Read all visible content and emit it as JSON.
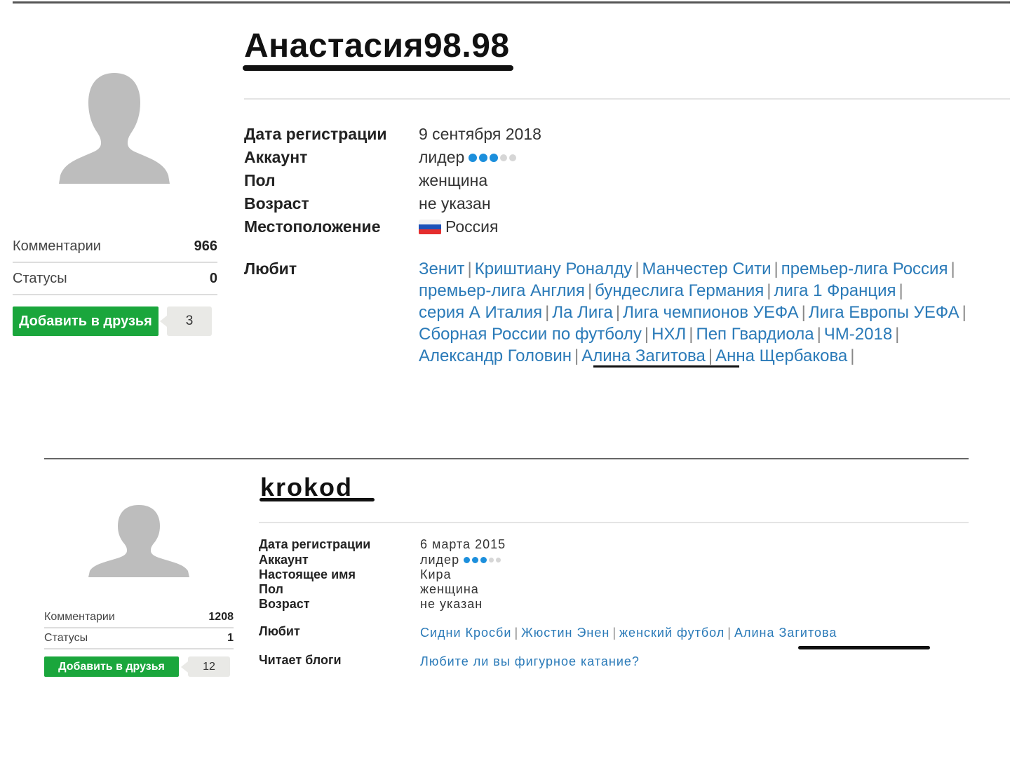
{
  "profile1": {
    "username": "Анастасия98.98",
    "stats": {
      "comments_label": "Комментарии",
      "comments_value": "966",
      "statuses_label": "Статусы",
      "statuses_value": "0"
    },
    "add_friend_label": "Добавить в друзья",
    "friend_count": "3",
    "info": {
      "reg_label": "Дата регистрации",
      "reg_value": "9 сентября 2018",
      "account_label": "Аккаунт",
      "account_value": "лидер",
      "account_level": 3,
      "account_level_max": 5,
      "gender_label": "Пол",
      "gender_value": "женщина",
      "age_label": "Возраст",
      "age_value": "не указан",
      "location_label": "Местоположение",
      "location_value": "Россия",
      "likes_label": "Любит"
    },
    "likes": [
      [
        "Зенит",
        "Криштиану Роналду",
        "Манчестер Сити",
        "премьер-лига Россия"
      ],
      [
        "премьер-лига Англия",
        "бундеслига Германия",
        "лига 1 Франция"
      ],
      [
        "серия А Италия",
        "Ла Лига",
        "Лига чемпионов УЕФА",
        "Лига Европы УЕФА"
      ],
      [
        "Сборная России по футболу",
        "НХЛ",
        "Пеп Гвардиола",
        "ЧМ-2018"
      ],
      [
        "Александр Головин",
        "Алина Загитова",
        "Анна Щербакова"
      ]
    ]
  },
  "profile2": {
    "username": "krokod",
    "stats": {
      "comments_label": "Комментарии",
      "comments_value": "1208",
      "statuses_label": "Статусы",
      "statuses_value": "1"
    },
    "add_friend_label": "Добавить в друзья",
    "friend_count": "12",
    "info": {
      "reg_label": "Дата регистрации",
      "reg_value": "6 марта 2015",
      "account_label": "Аккаунт",
      "account_value": "лидер",
      "account_level": 3,
      "account_level_max": 5,
      "realname_label": "Настоящее имя",
      "realname_value": "Кира",
      "gender_label": "Пол",
      "gender_value": "женщина",
      "age_label": "Возраст",
      "age_value": "не указан",
      "likes_label": "Любит",
      "blogs_label": "Читает блоги"
    },
    "likes": [
      [
        "Сидни Кросби",
        "Жюстин Энен",
        "женский футбол",
        "Алина Загитова"
      ]
    ],
    "blogs": [
      "Любите ли вы фигурное катание?"
    ]
  },
  "colors": {
    "accent_green": "#1aa63c",
    "link_blue": "#2a7ab8",
    "dot_blue": "#1c8fdc"
  }
}
